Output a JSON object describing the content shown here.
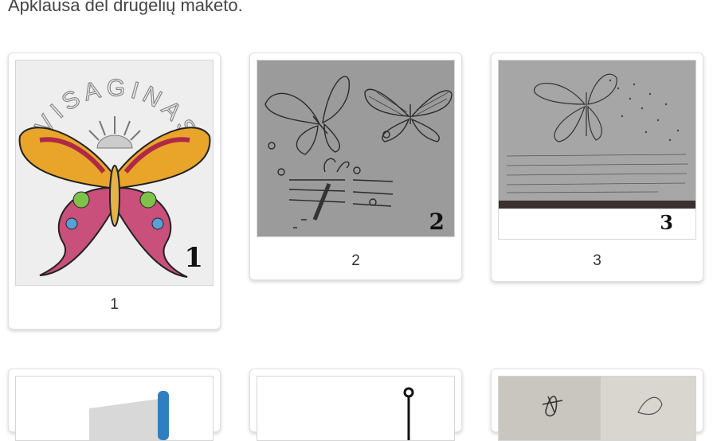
{
  "survey": {
    "title": "Apklausa dėl drugelių maketo."
  },
  "options": [
    {
      "caption": "1",
      "tag": "1",
      "image": "butterfly-colorful-visaginas",
      "image_text": "VISAGINAS"
    },
    {
      "caption": "2",
      "tag": "2",
      "image": "butterfly-pencil-sketches-three"
    },
    {
      "caption": "3",
      "tag": "3",
      "image": "butterfly-pencil-sketch-with-handwriting"
    },
    {
      "caption": "",
      "image": "partial-blue-object"
    },
    {
      "caption": "",
      "image": "partial-line-drawing"
    },
    {
      "caption": "",
      "image": "partial-photo-sketch"
    }
  ],
  "colors": {
    "card_border": "#e1e1e1",
    "sketch_bg": "#9b9b9b",
    "text": "#333333"
  }
}
